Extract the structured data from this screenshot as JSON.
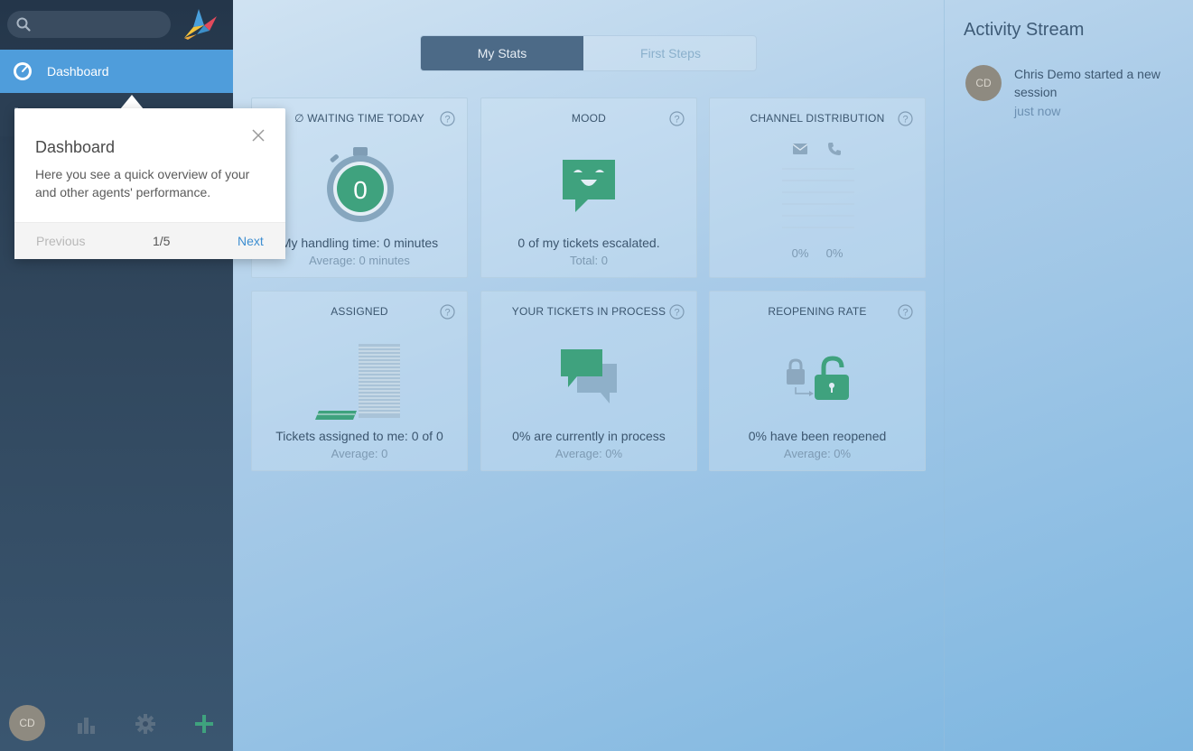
{
  "sidebar": {
    "search": {
      "placeholder": ""
    },
    "nav": {
      "dashboard_label": "Dashboard"
    },
    "user_initials": "CD"
  },
  "popover": {
    "title": "Dashboard",
    "body": "Here you see a quick overview of your and other agents' performance.",
    "previous_label": "Previous",
    "step": "1/5",
    "next_label": "Next"
  },
  "tabs": {
    "my_stats": "My Stats",
    "first_steps": "First Steps"
  },
  "cards": {
    "waiting": {
      "title": "∅ WAITING TIME TODAY",
      "value": "0",
      "main": "My handling time: 0 minutes",
      "sub": "Average: 0 minutes"
    },
    "mood": {
      "title": "MOOD",
      "main": "0 of my tickets escalated.",
      "sub": "Total: 0"
    },
    "channel": {
      "title": "CHANNEL DISTRIBUTION",
      "email_pct": "0%",
      "phone_pct": "0%"
    },
    "assigned": {
      "title": "ASSIGNED",
      "main": "Tickets assigned to me: 0 of 0",
      "sub": "Average: 0"
    },
    "in_process": {
      "title": "YOUR TICKETS IN PROCESS",
      "main": "0% are currently in process",
      "sub": "Average: 0%"
    },
    "reopening": {
      "title": "REOPENING RATE",
      "main": "0% have been reopened",
      "sub": "Average: 0%"
    }
  },
  "activity": {
    "title": "Activity Stream",
    "items": [
      {
        "initials": "CD",
        "text": "Chris Demo started a new session",
        "time": "just now"
      }
    ]
  },
  "colors": {
    "accent": "#4f9ddb",
    "green": "#3fa27e",
    "sidebar": "#2b3f54"
  }
}
